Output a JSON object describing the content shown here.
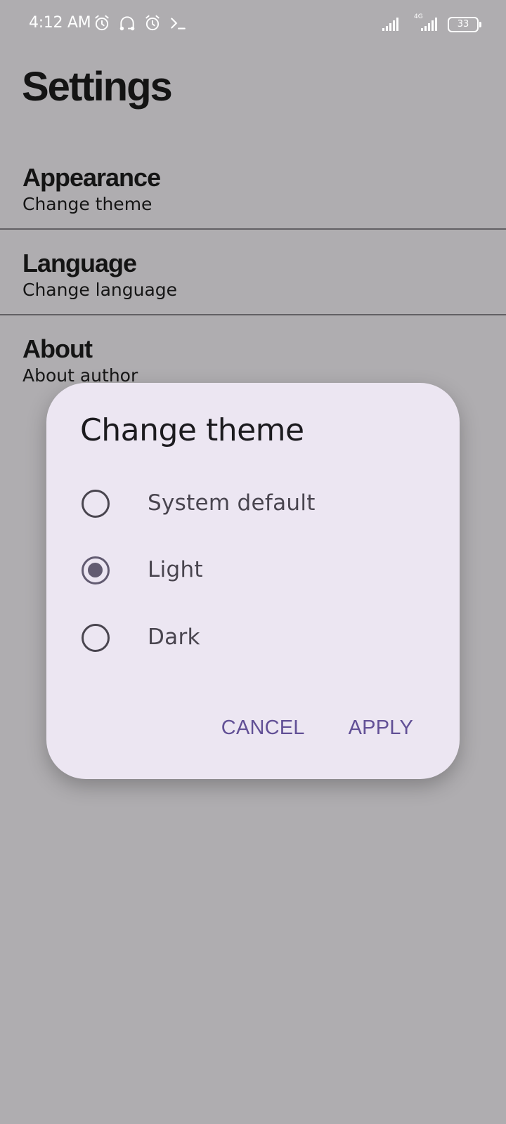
{
  "status_bar": {
    "time": "4:12 AM",
    "network": "4G",
    "battery": "33",
    "icons": [
      "alarm-icon",
      "headset-icon",
      "alarm-icon",
      "terminal-icon",
      "signal-icon",
      "signal-icon",
      "battery-icon"
    ]
  },
  "page": {
    "title": "Settings",
    "items": [
      {
        "title": "Appearance",
        "subtitle": "Change theme"
      },
      {
        "title": "Language",
        "subtitle": "Change language"
      },
      {
        "title": "About",
        "subtitle": "About author"
      }
    ]
  },
  "dialog": {
    "title": "Change theme",
    "options": [
      {
        "label": "System default",
        "selected": false
      },
      {
        "label": "Light",
        "selected": true
      },
      {
        "label": "Dark",
        "selected": false
      }
    ],
    "cancel_label": "CANCEL",
    "apply_label": "APPLY"
  },
  "colors": {
    "scrim_background": "#afadb0",
    "dialog_background": "#ece6f2",
    "accent": "#625096",
    "radio_selected": "#625b71"
  }
}
